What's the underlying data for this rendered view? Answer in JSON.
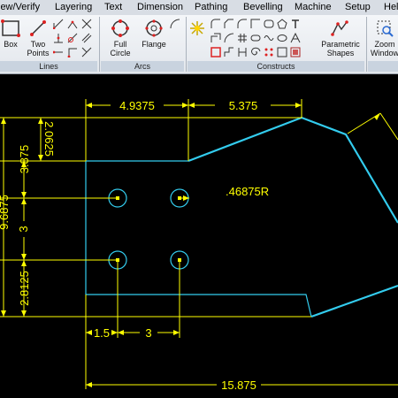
{
  "menu": {
    "items": [
      "iew/Verify",
      "Layering",
      "Text",
      "Dimension",
      "Pathing",
      "Bevelling",
      "Machine",
      "Setup",
      "Hel"
    ]
  },
  "ribbon": {
    "groups": {
      "lines": "Lines",
      "arcs": "Arcs",
      "constructs": "Constructs"
    },
    "buttons": {
      "box": "Box",
      "two_points_1": "Two",
      "two_points_2": "Points",
      "full_circle_1": "Full",
      "full_circle_2": "Circle",
      "flange": "Flange",
      "parametric_1": "Parametric",
      "parametric_2": "Shapes",
      "zoom_1": "Zoom",
      "zoom_2": "Window"
    }
  },
  "drawing": {
    "dims": {
      "top_left": "4.9375",
      "top_right": "5.375",
      "left_a": "2.0625",
      "left_b": "3.875",
      "left_overall": "9.6875",
      "left_c": "3",
      "left_d": "2.8125",
      "bottom_a": "1.5",
      "bottom_b": "3",
      "bottom_overall": "15.875",
      "radius": ".46875R"
    },
    "colors": {
      "geometry": "#33ccee",
      "dimension": "#ffff00",
      "background": "#000000"
    }
  }
}
